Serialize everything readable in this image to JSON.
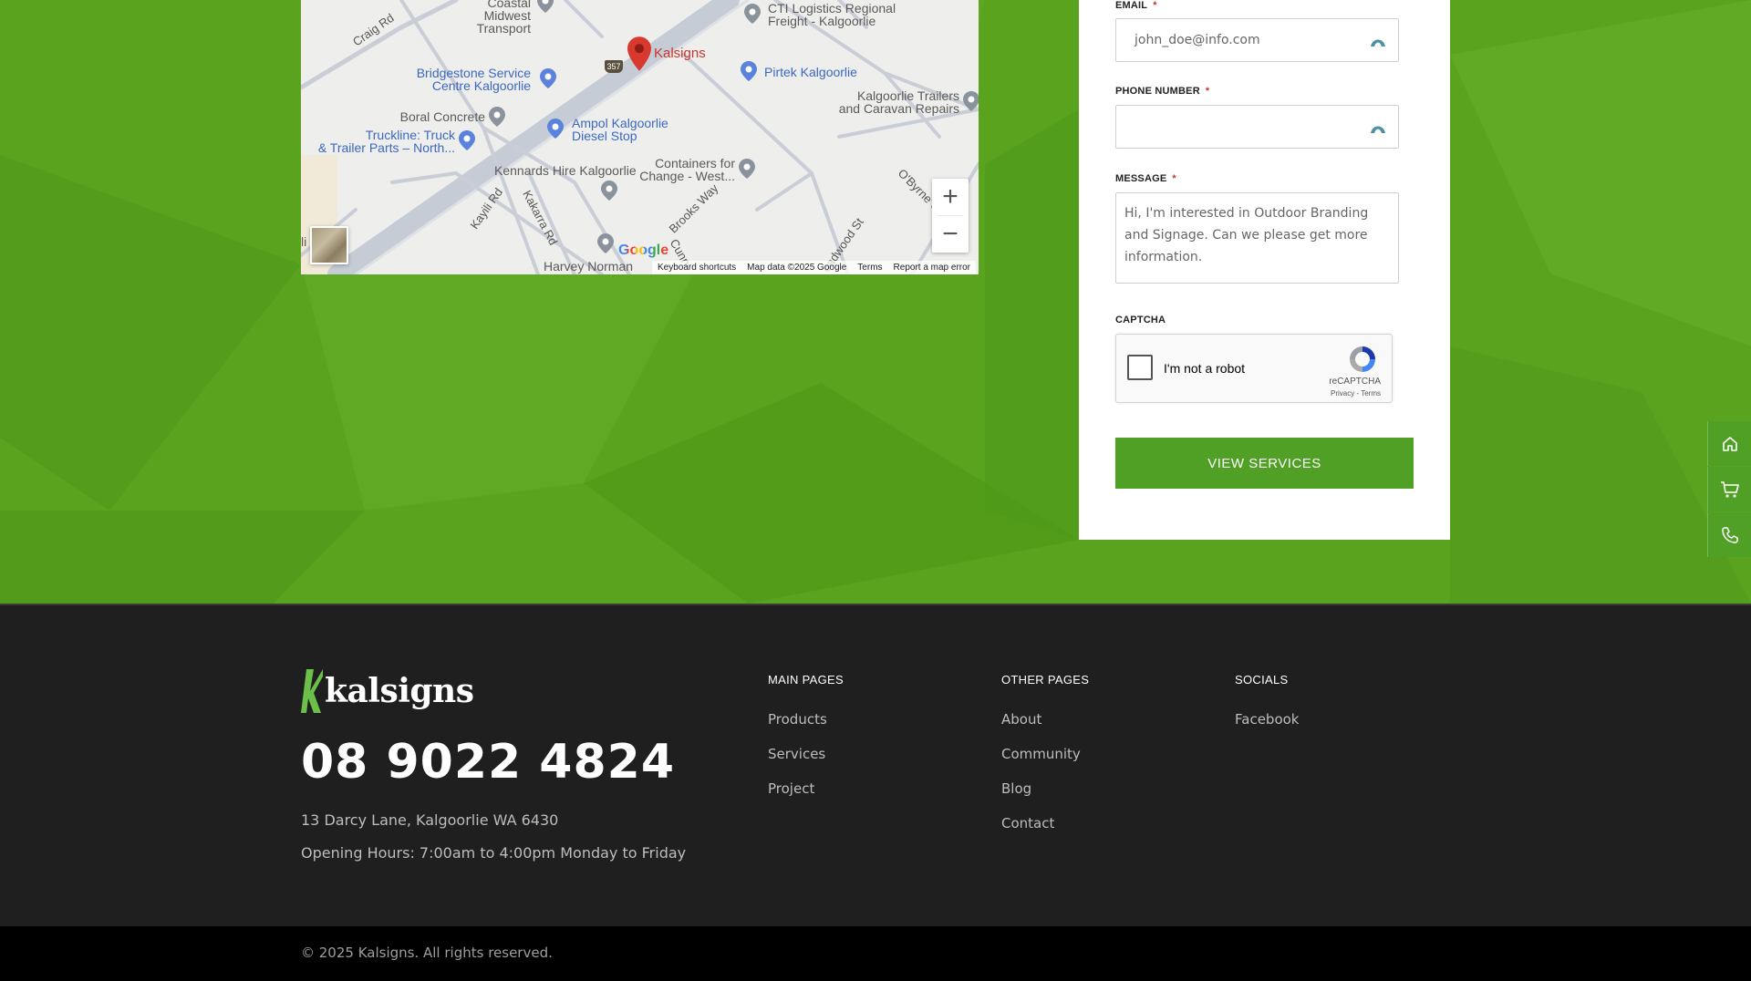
{
  "map": {
    "places": [
      {
        "text": "Coastal Midwest\nTransport",
        "style": "gray"
      },
      {
        "text": "CTI Logistics Regional\nFreight - Kalgoorlie",
        "style": "gray"
      },
      {
        "text": "Kalsigns",
        "style": "red"
      },
      {
        "text": "Bridgestone Service\nCentre Kalgoorlie",
        "style": "blue"
      },
      {
        "text": "Pirtek Kalgoorlie",
        "style": "blue"
      },
      {
        "text": "Kalgoorlie Trailers\nand Caravan Repairs",
        "style": "gray"
      },
      {
        "text": "Boral Concrete",
        "style": "gray"
      },
      {
        "text": "Ampol Kalgoorlie\nDiesel Stop",
        "style": "blue"
      },
      {
        "text": "Truckline: Truck\n& Trailer Parts – North...",
        "style": "blue"
      },
      {
        "text": "Kennards Hire Kalgoorlie",
        "style": "gray"
      },
      {
        "text": "Containers for\nChange - West...",
        "style": "gray"
      },
      {
        "text": "Harvey Norman",
        "style": "gray"
      }
    ],
    "roads": [
      "Craig Rd",
      "Kayili Rd",
      "Kakarra Rd",
      "Brooks Way",
      "O'Byrne C",
      "oadwood St",
      "Cunn"
    ],
    "shield": "357",
    "zoom_in": "+",
    "zoom_out": "−",
    "google": "Google",
    "footer": [
      "Keyboard shortcuts",
      "Map data ©2025 Google",
      "Terms",
      "Report a map error"
    ],
    "edge_text": "li"
  },
  "form": {
    "email_label": "EMAIL",
    "email_value": "john_doe@info.com",
    "phone_label": "PHONE NUMBER",
    "phone_value": "",
    "message_label": "MESSAGE",
    "message_value": "Hi, I'm interested in Outdoor Branding and Signage. Can we please get more information.",
    "required_mark": "*",
    "captcha_label": "CAPTCHA",
    "captcha_text": "I'm not a robot",
    "captcha_brand": "reCAPTCHA",
    "captcha_links": "Privacy - Terms",
    "submit_label": "VIEW SERVICES"
  },
  "side_nav": [
    "home-icon",
    "cart-icon",
    "phone-icon"
  ],
  "footer": {
    "logo": "kalsigns",
    "phone": "08 9022 4824",
    "address": "13 Darcy Lane, Kalgoorlie WA 6430",
    "hours": "Opening Hours: 7:00am to 4:00pm Monday to Friday",
    "main_pages": {
      "heading": "MAIN PAGES",
      "links": [
        "Products",
        "Services",
        "Project"
      ]
    },
    "other_pages": {
      "heading": "OTHER PAGES",
      "links": [
        "About",
        "Community",
        "Blog",
        "Contact"
      ]
    },
    "socials": {
      "heading": "SOCIALS",
      "links": [
        "Facebook"
      ]
    },
    "copyright": "© 2025 Kalsigns. All rights reserved."
  },
  "colors": {
    "brand_green": "#5aa31f",
    "button_green": "#4fa024",
    "footer_bg": "#1f1f1f"
  }
}
